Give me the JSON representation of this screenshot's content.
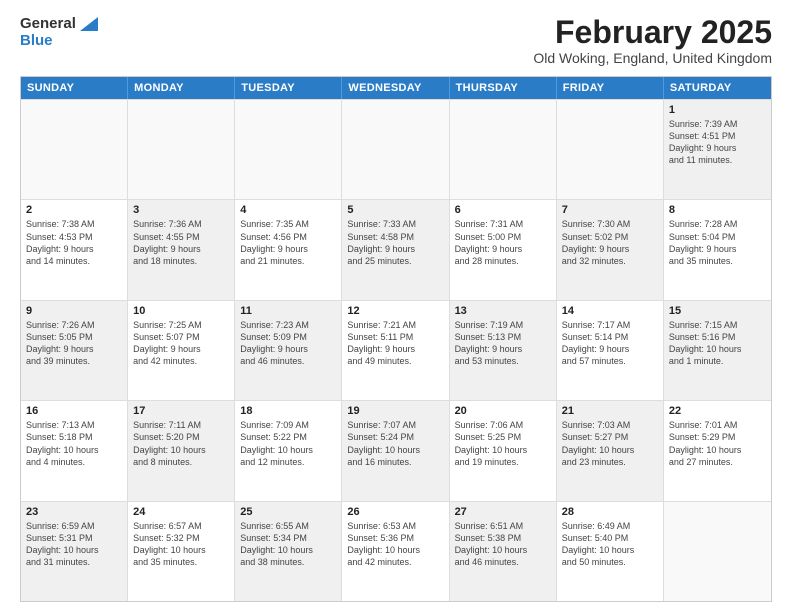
{
  "header": {
    "logo_general": "General",
    "logo_blue": "Blue",
    "title": "February 2025",
    "location": "Old Woking, England, United Kingdom"
  },
  "days_of_week": [
    "Sunday",
    "Monday",
    "Tuesday",
    "Wednesday",
    "Thursday",
    "Friday",
    "Saturday"
  ],
  "weeks": [
    [
      {
        "day": "",
        "info": "",
        "empty": true
      },
      {
        "day": "",
        "info": "",
        "empty": true
      },
      {
        "day": "",
        "info": "",
        "empty": true
      },
      {
        "day": "",
        "info": "",
        "empty": true
      },
      {
        "day": "",
        "info": "",
        "empty": true
      },
      {
        "day": "",
        "info": "",
        "empty": true
      },
      {
        "day": "1",
        "info": "Sunrise: 7:39 AM\nSunset: 4:51 PM\nDaylight: 9 hours\nand 11 minutes.",
        "shaded": true
      }
    ],
    [
      {
        "day": "2",
        "info": "Sunrise: 7:38 AM\nSunset: 4:53 PM\nDaylight: 9 hours\nand 14 minutes.",
        "shaded": false
      },
      {
        "day": "3",
        "info": "Sunrise: 7:36 AM\nSunset: 4:55 PM\nDaylight: 9 hours\nand 18 minutes.",
        "shaded": true
      },
      {
        "day": "4",
        "info": "Sunrise: 7:35 AM\nSunset: 4:56 PM\nDaylight: 9 hours\nand 21 minutes.",
        "shaded": false
      },
      {
        "day": "5",
        "info": "Sunrise: 7:33 AM\nSunset: 4:58 PM\nDaylight: 9 hours\nand 25 minutes.",
        "shaded": true
      },
      {
        "day": "6",
        "info": "Sunrise: 7:31 AM\nSunset: 5:00 PM\nDaylight: 9 hours\nand 28 minutes.",
        "shaded": false
      },
      {
        "day": "7",
        "info": "Sunrise: 7:30 AM\nSunset: 5:02 PM\nDaylight: 9 hours\nand 32 minutes.",
        "shaded": true
      },
      {
        "day": "8",
        "info": "Sunrise: 7:28 AM\nSunset: 5:04 PM\nDaylight: 9 hours\nand 35 minutes.",
        "shaded": false
      }
    ],
    [
      {
        "day": "9",
        "info": "Sunrise: 7:26 AM\nSunset: 5:05 PM\nDaylight: 9 hours\nand 39 minutes.",
        "shaded": true
      },
      {
        "day": "10",
        "info": "Sunrise: 7:25 AM\nSunset: 5:07 PM\nDaylight: 9 hours\nand 42 minutes.",
        "shaded": false
      },
      {
        "day": "11",
        "info": "Sunrise: 7:23 AM\nSunset: 5:09 PM\nDaylight: 9 hours\nand 46 minutes.",
        "shaded": true
      },
      {
        "day": "12",
        "info": "Sunrise: 7:21 AM\nSunset: 5:11 PM\nDaylight: 9 hours\nand 49 minutes.",
        "shaded": false
      },
      {
        "day": "13",
        "info": "Sunrise: 7:19 AM\nSunset: 5:13 PM\nDaylight: 9 hours\nand 53 minutes.",
        "shaded": true
      },
      {
        "day": "14",
        "info": "Sunrise: 7:17 AM\nSunset: 5:14 PM\nDaylight: 9 hours\nand 57 minutes.",
        "shaded": false
      },
      {
        "day": "15",
        "info": "Sunrise: 7:15 AM\nSunset: 5:16 PM\nDaylight: 10 hours\nand 1 minute.",
        "shaded": true
      }
    ],
    [
      {
        "day": "16",
        "info": "Sunrise: 7:13 AM\nSunset: 5:18 PM\nDaylight: 10 hours\nand 4 minutes.",
        "shaded": false
      },
      {
        "day": "17",
        "info": "Sunrise: 7:11 AM\nSunset: 5:20 PM\nDaylight: 10 hours\nand 8 minutes.",
        "shaded": true
      },
      {
        "day": "18",
        "info": "Sunrise: 7:09 AM\nSunset: 5:22 PM\nDaylight: 10 hours\nand 12 minutes.",
        "shaded": false
      },
      {
        "day": "19",
        "info": "Sunrise: 7:07 AM\nSunset: 5:24 PM\nDaylight: 10 hours\nand 16 minutes.",
        "shaded": true
      },
      {
        "day": "20",
        "info": "Sunrise: 7:06 AM\nSunset: 5:25 PM\nDaylight: 10 hours\nand 19 minutes.",
        "shaded": false
      },
      {
        "day": "21",
        "info": "Sunrise: 7:03 AM\nSunset: 5:27 PM\nDaylight: 10 hours\nand 23 minutes.",
        "shaded": true
      },
      {
        "day": "22",
        "info": "Sunrise: 7:01 AM\nSunset: 5:29 PM\nDaylight: 10 hours\nand 27 minutes.",
        "shaded": false
      }
    ],
    [
      {
        "day": "23",
        "info": "Sunrise: 6:59 AM\nSunset: 5:31 PM\nDaylight: 10 hours\nand 31 minutes.",
        "shaded": true
      },
      {
        "day": "24",
        "info": "Sunrise: 6:57 AM\nSunset: 5:32 PM\nDaylight: 10 hours\nand 35 minutes.",
        "shaded": false
      },
      {
        "day": "25",
        "info": "Sunrise: 6:55 AM\nSunset: 5:34 PM\nDaylight: 10 hours\nand 38 minutes.",
        "shaded": true
      },
      {
        "day": "26",
        "info": "Sunrise: 6:53 AM\nSunset: 5:36 PM\nDaylight: 10 hours\nand 42 minutes.",
        "shaded": false
      },
      {
        "day": "27",
        "info": "Sunrise: 6:51 AM\nSunset: 5:38 PM\nDaylight: 10 hours\nand 46 minutes.",
        "shaded": true
      },
      {
        "day": "28",
        "info": "Sunrise: 6:49 AM\nSunset: 5:40 PM\nDaylight: 10 hours\nand 50 minutes.",
        "shaded": false
      },
      {
        "day": "",
        "info": "",
        "empty": true
      }
    ]
  ]
}
